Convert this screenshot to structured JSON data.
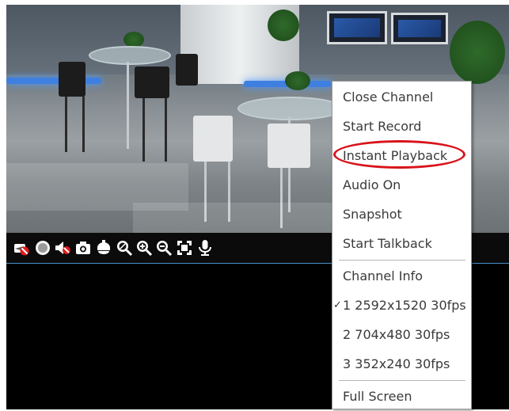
{
  "toolbar": {
    "icons": [
      "camera-disabled-icon",
      "record-dot-icon",
      "mute-icon",
      "snapshot-icon",
      "ptz-icon",
      "zoom-reset-icon",
      "zoom-in-icon",
      "zoom-out-icon",
      "fit-screen-icon",
      "microphone-icon"
    ]
  },
  "context_menu": {
    "items": [
      {
        "label": "Close Channel"
      },
      {
        "label": "Start Record"
      },
      {
        "label": "Instant Playback",
        "highlighted": true
      },
      {
        "label": "Audio On"
      },
      {
        "label": "Snapshot"
      },
      {
        "label": "Start Talkback"
      },
      {
        "label": "Channel Info"
      },
      {
        "label": "1 2592x1520 30fps",
        "checked": true
      },
      {
        "label": "2 704x480 30fps"
      },
      {
        "label": "3 352x240 30fps"
      },
      {
        "label": "Full Screen"
      }
    ],
    "check_mark": "✓"
  },
  "colors": {
    "highlight_ring": "#d8141c",
    "toolbar_bg": "#0b0b0b",
    "divider": "#4a90c8"
  }
}
